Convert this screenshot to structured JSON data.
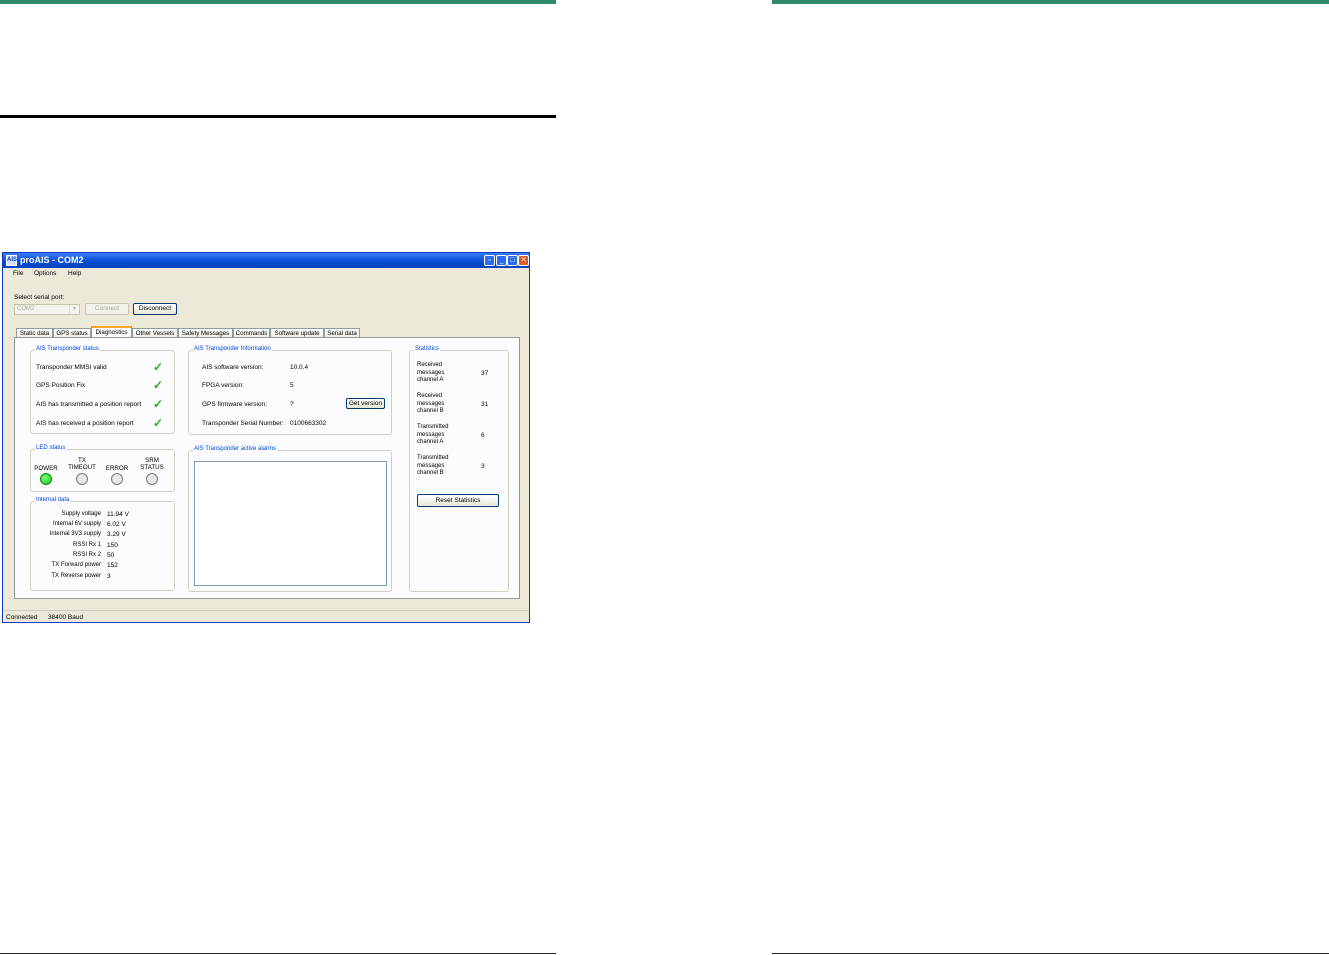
{
  "window": {
    "title": "proAIS - COM2",
    "icon_label": "AIS",
    "minimize_icon": "_",
    "restore_icon": "▫",
    "maximize_icon": "□",
    "close_icon": "✕"
  },
  "menu": [
    "File",
    "Options",
    "Help"
  ],
  "serial": {
    "label": "Select serial port:",
    "port_value": "COM2",
    "connect_label": "Connect",
    "disconnect_label": "Disconnect"
  },
  "tabs": [
    "Static data",
    "GPS status",
    "Diagnostics",
    "Other Vessels",
    "Safety Messages",
    "Commands",
    "Software update",
    "Serial data"
  ],
  "active_tab": "Diagnostics",
  "transponder_status": {
    "title": "AIS Transponder status",
    "items": [
      {
        "label": "Transponder MMSI valid",
        "ok": true
      },
      {
        "label": "GPS Position Fix",
        "ok": true
      },
      {
        "label": "AIS has transmitted a position report",
        "ok": true
      },
      {
        "label": "AIS has received a position report",
        "ok": true
      }
    ],
    "check_glyph": "✓"
  },
  "led_status": {
    "title": "LED status",
    "leds": [
      {
        "label": "POWER",
        "on": true
      },
      {
        "label": "TX\nTIMEOUT",
        "on": false
      },
      {
        "label": "ERROR",
        "on": false
      },
      {
        "label": "SRM\nSTATUS",
        "on": false
      }
    ]
  },
  "internal_data": {
    "title": "Internal data",
    "rows": [
      {
        "label": "Supply voltage",
        "value": "11.94 V"
      },
      {
        "label": "Internal 6V supply",
        "value": "6.02 V"
      },
      {
        "label": "Internal 3V3 supply",
        "value": "3.29 V"
      },
      {
        "label": "RSSI Rx 1",
        "value": "150"
      },
      {
        "label": "RSSI Rx 2",
        "value": "50"
      },
      {
        "label": "TX Forward power",
        "value": "152"
      },
      {
        "label": "TX Reverse power",
        "value": "3"
      }
    ]
  },
  "transponder_info": {
    "title": "AIS Transponder Information",
    "rows": [
      {
        "label": "AIS software version:",
        "value": "10.0.4"
      },
      {
        "label": "FPGA version:",
        "value": "5"
      },
      {
        "label": "GPS firmware version:",
        "value": "?"
      },
      {
        "label": "Transponder Serial Number:",
        "value": "0100663302"
      }
    ],
    "get_version_label": "Get version"
  },
  "alarms": {
    "title": "AIS Transponder active alarms"
  },
  "statistics": {
    "title": "Statistics",
    "rows": [
      {
        "label": "Received\nmessages\nchannel A",
        "value": "37"
      },
      {
        "label": "Received\nmessages\nchannel B",
        "value": "31"
      },
      {
        "label": "Transmitted\nmessages\nchannel A",
        "value": "6"
      },
      {
        "label": "Transmitted\nmessages\nchannel B",
        "value": "3"
      }
    ],
    "reset_label": "Reset Statistics"
  },
  "statusbar": {
    "state": "Connected",
    "baud": "38400 Baud"
  },
  "colors": {
    "header_rule": "#2e8b6e",
    "titlebar": "#0a50d8",
    "group_title": "#0046d5",
    "check": "#22b014",
    "led_on": "#14c814"
  }
}
